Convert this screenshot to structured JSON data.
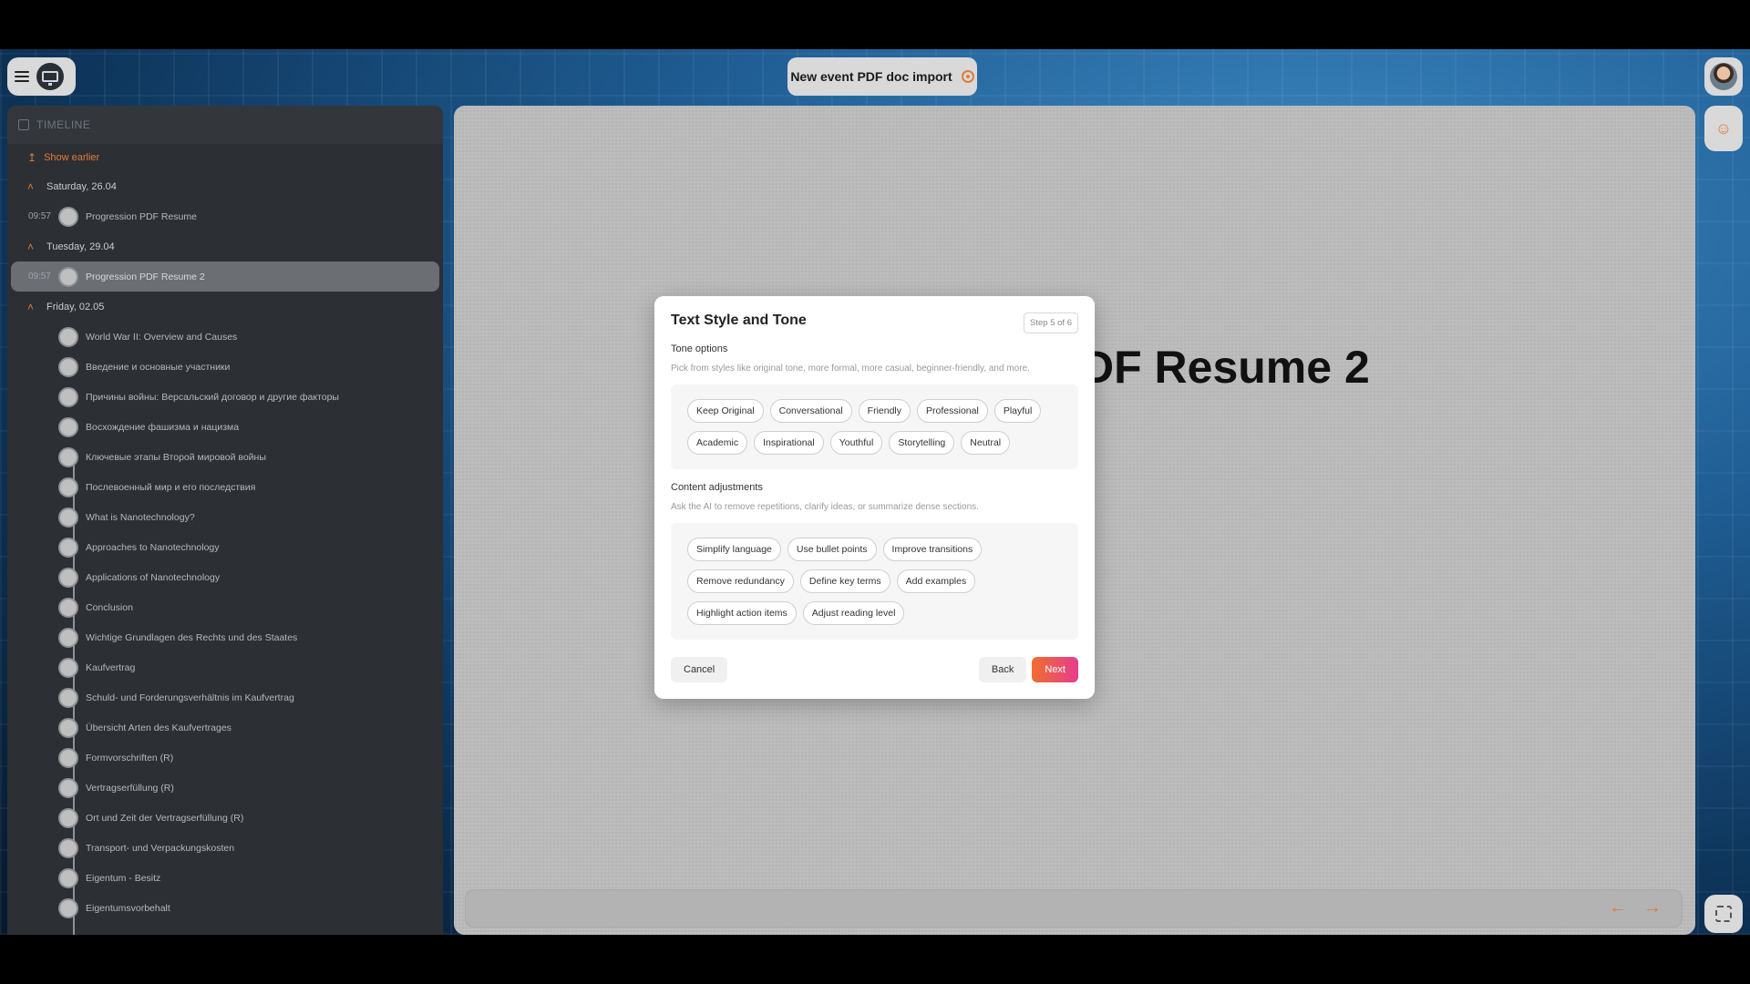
{
  "header": {
    "title": "New event PDF doc import"
  },
  "sidebar": {
    "header": "TIMELINE",
    "show_earlier": "Show earlier",
    "groups": [
      {
        "date": "Saturday, 26.04",
        "items": [
          {
            "time": "09:57",
            "label": "Progression PDF Resume"
          }
        ]
      },
      {
        "date": "Tuesday, 29.04",
        "items": [
          {
            "time": "09:57",
            "label": "Progression PDF Resume 2"
          }
        ]
      },
      {
        "date": "Friday, 02.05",
        "items": [
          {
            "label": "World War II: Overview and Causes"
          },
          {
            "label": "Введение и основные участники"
          },
          {
            "label": "Причины войны: Версальский договор и другие факторы"
          },
          {
            "label": "Восхождение фашизма и нацизма"
          },
          {
            "label": "Ключевые этапы Второй мировой войны"
          },
          {
            "label": "Послевоенный мир и его последствия"
          },
          {
            "label": "What is Nanotechnology?"
          },
          {
            "label": "Approaches to Nanotechnology"
          },
          {
            "label": "Applications of Nanotechnology"
          },
          {
            "label": "Conclusion"
          },
          {
            "label": "Wichtige Grundlagen des Rechts und des Staates"
          },
          {
            "label": "Kaufvertrag"
          },
          {
            "label": "Schuld- und Forderungsverhältnis im Kaufvertrag"
          },
          {
            "label": "Übersicht Arten des Kaufvertrages"
          },
          {
            "label": "Formvorschriften (R)"
          },
          {
            "label": "Vertragserfüllung (R)"
          },
          {
            "label": "Ort und Zeit der Vertragserfüllung (R)"
          },
          {
            "label": "Transport- und Verpackungskosten"
          },
          {
            "label": "Eigentum - Besitz"
          },
          {
            "label": "Eigentumsvorbehalt"
          }
        ]
      }
    ]
  },
  "main": {
    "doc_title": "DF Resume 2"
  },
  "modal": {
    "title": "Text Style and Tone",
    "step": "Step 5 of 6",
    "tone": {
      "title": "Tone options",
      "desc": "Pick from styles like original tone, more formal, more casual, beginner-friendly, and more.",
      "chips": [
        "Keep Original",
        "Conversational",
        "Friendly",
        "Professional",
        "Playful",
        "Academic",
        "Inspirational",
        "Youthful",
        "Storytelling",
        "Neutral"
      ]
    },
    "content": {
      "title": "Content adjustments",
      "desc": "Ask the AI to remove repetitions, clarify ideas, or summarize dense sections.",
      "chips": [
        "Simplify language",
        "Use bullet points",
        "Improve transitions",
        "Remove redundancy",
        "Define key terms",
        "Add examples",
        "Highlight action items",
        "Adjust reading level"
      ]
    },
    "cancel_label": "Cancel",
    "back_label": "Back",
    "next_label": "Next"
  },
  "icons": {
    "menu": "hamburger-icon",
    "monitor": "monitor-icon",
    "settings": "gear-icon",
    "avatar": "user-avatar",
    "people": "people-icon",
    "fullscreen": "fullscreen-icon",
    "prev": "arrow-left-icon",
    "next": "arrow-right-icon"
  },
  "colors": {
    "accent": "#e07b39",
    "next_gradient_start": "#f06d2f",
    "next_gradient_end": "#e53d8f"
  }
}
